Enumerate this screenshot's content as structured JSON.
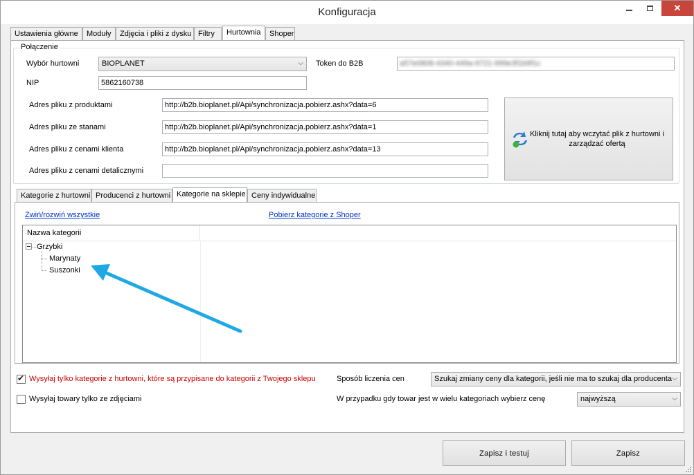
{
  "window": {
    "title": "Konfiguracja"
  },
  "main_tabs": [
    {
      "label": "Ustawienia główne"
    },
    {
      "label": "Moduły"
    },
    {
      "label": "Zdjęcia i pliki z dysku"
    },
    {
      "label": "Filtry"
    },
    {
      "label": "Hurtownia"
    },
    {
      "label": "Shoper"
    }
  ],
  "connection": {
    "title": "Połączenie",
    "wholesaler_label": "Wybór hurtowni",
    "wholesaler_value": "BIOPLANET",
    "token_label": "Token do B2B",
    "token_value": "a57e0808-4340-449a-9721-999e3f1b9f1c",
    "nip_label": "NIP",
    "nip_value": "5862160738",
    "products_label": "Adres pliku z produktami",
    "products_value": "http://b2b.bioplanet.pl/Api/synchronizacja.pobierz.ashx?data=6",
    "stock_label": "Adres pliku ze stanami",
    "stock_value": "http://b2b.bioplanet.pl/Api/synchronizacja.pobierz.ashx?data=1",
    "client_prices_label": "Adres pliku z cenami klienta",
    "client_prices_value": "http://b2b.bioplanet.pl/Api/synchronizacja.pobierz.ashx?data=13",
    "retail_prices_label": "Adres pliku z cenami detalicznymi",
    "retail_prices_value": "",
    "load_button": "Kliknij tutaj aby wczytać plik z hurtowni i zarządzać ofertą"
  },
  "sub_tabs": [
    {
      "label": "Kategorie z hurtowni"
    },
    {
      "label": "Producenci z hurtowni"
    },
    {
      "label": "Kategorie na sklepie"
    },
    {
      "label": "Ceny indywidualne"
    }
  ],
  "categories": {
    "collapse_link": "Zwiń/rozwiń wszystkie",
    "fetch_link": "Pobierz kategorie z Shoper",
    "column_header": "Nazwa kategorii",
    "root": "Grzybki",
    "children": [
      "Marynaty",
      "Suszonki"
    ]
  },
  "options": {
    "send_only_assigned": "Wysyłaj tylko kategorie z hurtowni, które są przypisane do kategorii z Twojego sklepu",
    "send_only_with_photos": "Wysyłaj towary tylko ze zdjęciami",
    "price_method_label": "Sposób liczenia cen",
    "price_method_value": "Szukaj zmiany ceny dla kategorii, jeśli nie ma to szukaj dla producenta",
    "multi_category_label": "W przypadku gdy towar jest w wielu kategoriach wybierz cenę",
    "multi_category_value": "najwyższą"
  },
  "buttons": {
    "save_test": "Zapisz i testuj",
    "save": "Zapisz"
  },
  "colors": {
    "warning_text": "#cc0000",
    "link": "#0033cc",
    "arrow": "#1fa8e6",
    "close_button": "#c7453a"
  }
}
